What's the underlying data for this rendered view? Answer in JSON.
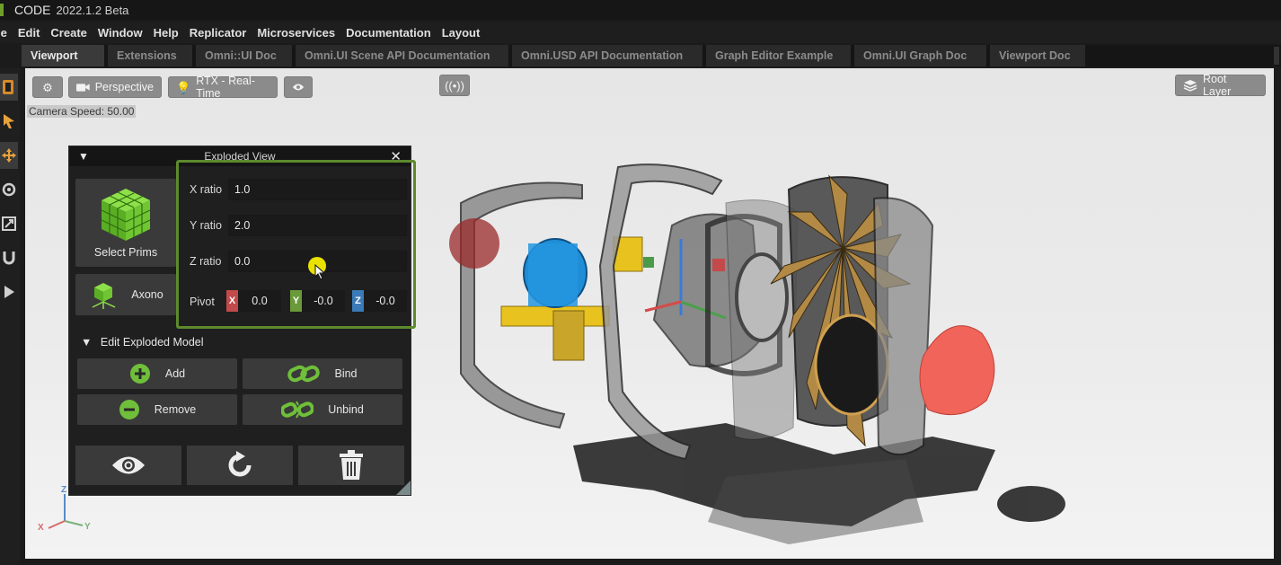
{
  "titlebar": {
    "app": "CODE",
    "version": "2022.1.2 Beta"
  },
  "menu": [
    "le",
    "Edit",
    "Create",
    "Window",
    "Help",
    "Replicator",
    "Microservices",
    "Documentation",
    "Layout"
  ],
  "tabs": [
    {
      "label": "Viewport",
      "active": true
    },
    {
      "label": "Extensions",
      "active": false
    },
    {
      "label": "Omni::UI Doc",
      "active": false
    },
    {
      "label": "Omni.UI Scene API Documentation",
      "active": false
    },
    {
      "label": "Omni.USD API Documentation",
      "active": false
    },
    {
      "label": "Graph Editor Example",
      "active": false
    },
    {
      "label": "Omni.UI Graph Doc",
      "active": false
    },
    {
      "label": "Viewport Doc",
      "active": false
    }
  ],
  "viewport": {
    "settings_icon": "gear-icon",
    "camera_label": "Perspective",
    "renderer_label": "RTX - Real-Time",
    "visibility_icon": "eye-icon",
    "stream_icon": "broadcast-icon",
    "layer_label": "Root Layer",
    "camera_speed": "Camera Speed: 50.00",
    "axis": {
      "z": "Z",
      "x": "X",
      "y": "Y"
    }
  },
  "panel": {
    "title": "Exploded View",
    "select_prims_label": "Select Prims",
    "axono_label": "Axono",
    "fields": {
      "x_ratio_label": "X ratio",
      "x_ratio": "1.0",
      "y_ratio_label": "Y ratio",
      "y_ratio": "2.0",
      "z_ratio_label": "Z ratio",
      "z_ratio": "0.0"
    },
    "pivot": {
      "label": "Pivot",
      "x_tag": "X",
      "x": "0.0",
      "y_tag": "Y",
      "y": "-0.0",
      "z_tag": "Z",
      "z": "-0.0"
    },
    "section_title": "Edit Exploded Model",
    "actions": {
      "add": "Add",
      "bind": "Bind",
      "remove": "Remove",
      "unbind": "Unbind"
    },
    "colors": {
      "accent_green": "#5c8a2c",
      "x_red": "#c24a4a",
      "y_green": "#6a9a3a",
      "z_blue": "#3a7ab8"
    }
  }
}
